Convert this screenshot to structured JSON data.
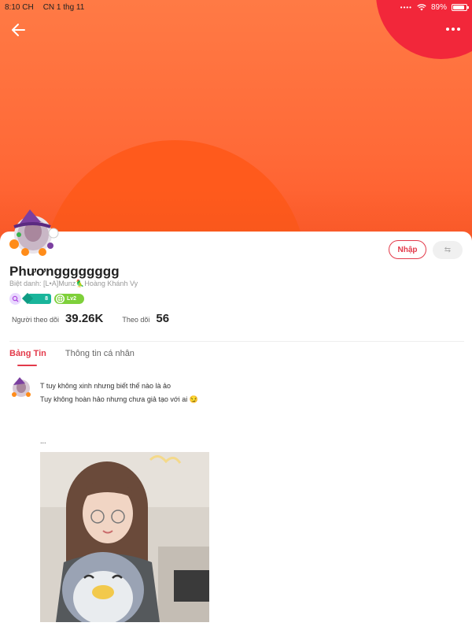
{
  "status_bar": {
    "time": "8:10 CH",
    "date": "CN 1 thg 11",
    "battery": "89%"
  },
  "header": {
    "back_icon": "arrow-left-icon",
    "more_icon": "more-dots-icon"
  },
  "profile": {
    "name": "Phươngggggggg",
    "nickname": "Biệt danh: [L•A]Munz🦜Hoàng Khánh Vy",
    "badges": {
      "level_badge_text": "8",
      "lv_badge_text": "Lv2"
    },
    "followers_label": "Người theo dõi",
    "followers_value": "39.26K",
    "following_label": "Theo dõi",
    "following_value": "56",
    "follow_button_label": "Nhập",
    "swap_button_label": "⇆"
  },
  "tabs": [
    {
      "label": "Bảng Tin",
      "active": true
    },
    {
      "label": "Thông tin cá nhân",
      "active": false
    }
  ],
  "post": {
    "line1": "T tuy không xinh nhưng biết thế nào là ảo",
    "line2": "Tuy không hoàn hảo nhưng chưa giả tạo với ai 😏",
    "ellipsis": "..."
  },
  "colors": {
    "accent": "#e33a4a",
    "cover_orange": "#ff6a38",
    "cover_red_circle": "#f2273a"
  }
}
